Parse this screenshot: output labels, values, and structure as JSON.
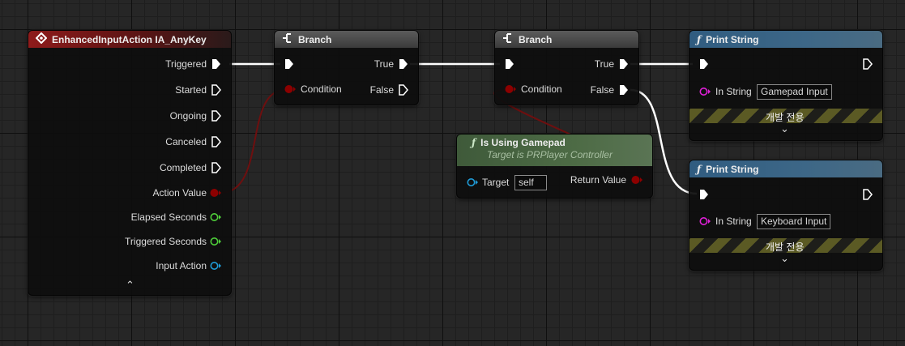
{
  "event_node": {
    "title": "EnhancedInputAction IA_AnyKey",
    "icon": "event-diamond-icon",
    "outputs": [
      "Triggered",
      "Started",
      "Ongoing",
      "Canceled",
      "Completed",
      "Action Value",
      "Elapsed Seconds",
      "Triggered Seconds",
      "Input Action"
    ],
    "collapse_glyph": "⌃"
  },
  "branch1": {
    "title": "Branch",
    "true_label": "True",
    "false_label": "False",
    "condition_label": "Condition"
  },
  "branch2": {
    "title": "Branch",
    "true_label": "True",
    "false_label": "False",
    "condition_label": "Condition"
  },
  "gamepad_node": {
    "title": "Is Using Gamepad",
    "subtitle": "Target is PRPlayer Controller",
    "target_label": "Target",
    "target_value": "self",
    "return_label": "Return Value"
  },
  "print1": {
    "title": "Print String",
    "in_string_label": "In String",
    "in_string_value": "Gamepad Input",
    "dev_only": "개발 전용",
    "expand_glyph": "⌄"
  },
  "print2": {
    "title": "Print String",
    "in_string_label": "In String",
    "in_string_value": "Keyboard Input",
    "dev_only": "개발 전용",
    "expand_glyph": "⌄"
  },
  "function_glyph": "ƒ",
  "colors": {
    "exec": "#ffffff",
    "bool_pin": "#8c0000",
    "float_pin": "#4fcf3a",
    "object_pin": "#1f9cd8",
    "string_pin": "#e020d8",
    "bool_wire": "#6e0f0f"
  }
}
